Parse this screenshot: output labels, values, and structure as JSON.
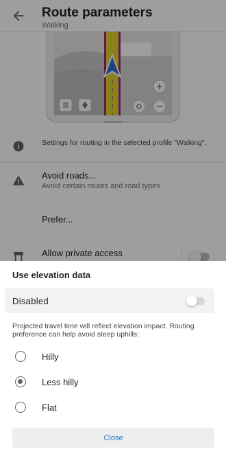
{
  "appbar": {
    "title": "Route parameters",
    "subtitle": "Walking"
  },
  "info": {
    "text": "Settings for routing in the selected profile \"Walking\"."
  },
  "avoid_roads": {
    "title": "Avoid roads...",
    "subtitle": "Avoid certain routes and road types"
  },
  "prefer": {
    "title": "Prefer..."
  },
  "private_access": {
    "title": "Allow private access",
    "enabled": false
  },
  "sheet": {
    "title": "Use elevation data",
    "toggle_label": "Disabled",
    "toggle_on": false,
    "description": "Projected travel time will reflect elevation impact. Routing preference can help avoid steep uphills:",
    "options": [
      {
        "label": "Hilly",
        "selected": false
      },
      {
        "label": "Less hilly",
        "selected": true
      },
      {
        "label": "Flat",
        "selected": false
      }
    ],
    "close_label": "Close"
  },
  "colors": {
    "accent": "#1976d2",
    "route": "#e0cf2e",
    "route_border": "#9c2b6e",
    "arrow": "#2f6fd6"
  }
}
